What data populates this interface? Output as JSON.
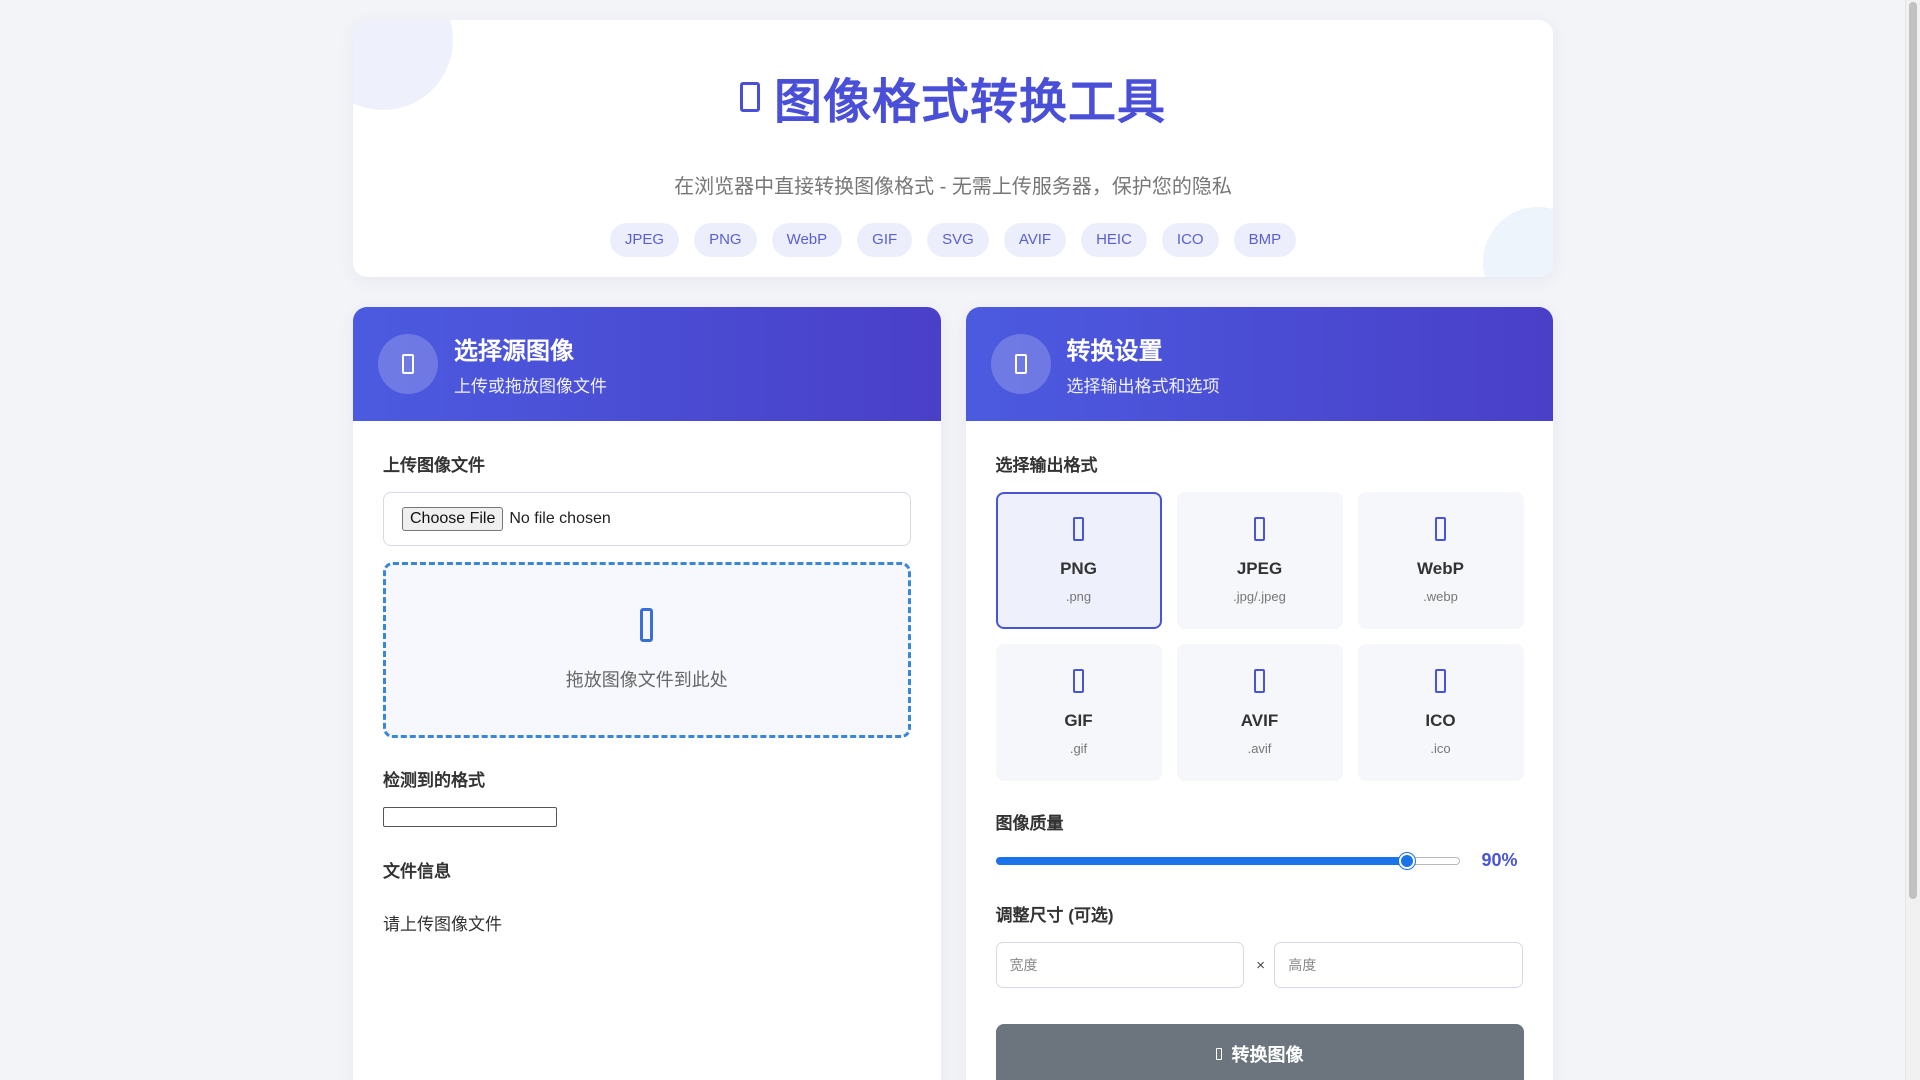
{
  "header": {
    "title": "图像格式转换工具",
    "subtitle": "在浏览器中直接转换图像格式 - 无需上传服务器，保护您的隐私",
    "badges": [
      "JPEG",
      "PNG",
      "WebP",
      "GIF",
      "SVG",
      "AVIF",
      "HEIC",
      "ICO",
      "BMP"
    ]
  },
  "source_panel": {
    "title": "选择源图像",
    "subtitle": "上传或拖放图像文件",
    "upload_label": "上传图像文件",
    "choose_file_button": "Choose File",
    "no_file_text": "No file chosen",
    "drop_text": "拖放图像文件到此处",
    "detected_label": "检测到的格式",
    "detected_value": "",
    "file_info_label": "文件信息",
    "file_info_text": "请上传图像文件"
  },
  "settings_panel": {
    "title": "转换设置",
    "subtitle": "选择输出格式和选项",
    "format_label": "选择输出格式",
    "selected_format": "PNG",
    "formats": [
      {
        "name": "PNG",
        "ext": ".png"
      },
      {
        "name": "JPEG",
        "ext": ".jpg/.jpeg"
      },
      {
        "name": "WebP",
        "ext": ".webp"
      },
      {
        "name": "GIF",
        "ext": ".gif"
      },
      {
        "name": "AVIF",
        "ext": ".avif"
      },
      {
        "name": "ICO",
        "ext": ".ico"
      }
    ],
    "quality_label": "图像质量",
    "quality_value": 90,
    "quality_display": "90%",
    "resize_label": "调整尺寸 (可选)",
    "width_placeholder": "宽度",
    "height_placeholder": "高度",
    "times_symbol": "×",
    "convert_button": "转换图像"
  },
  "colors": {
    "accent": "#4a55d6",
    "header_gradient_start": "#4b5be0",
    "header_gradient_end": "#4a3fc8",
    "convert_button": "#6c757d",
    "drop_border": "#3a86d9"
  },
  "icons": {
    "title": "image-icon",
    "source_head": "upload-icon",
    "settings_head": "settings-icon",
    "drop": "cloud-upload-icon",
    "format_card": "file-image-icon",
    "convert": "sync-icon"
  }
}
